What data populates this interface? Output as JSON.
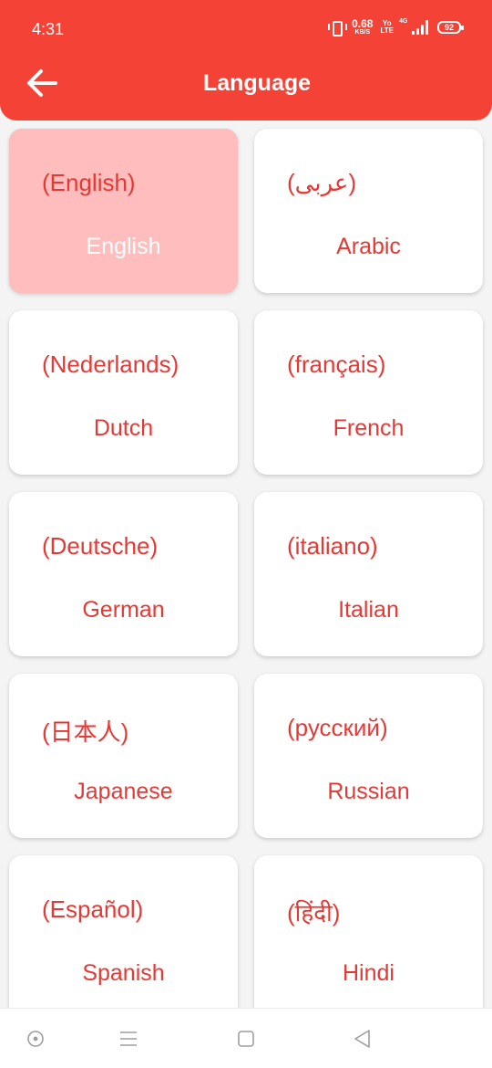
{
  "status_bar": {
    "time": "4:31",
    "speed_value": "0.68",
    "speed_unit": "KB/S",
    "volte_top": "Yo",
    "volte_bottom": "LTE",
    "network": "4G",
    "battery": "92"
  },
  "header": {
    "title": "Language",
    "back_icon": "arrow-left-icon"
  },
  "languages": [
    {
      "native": "(English)",
      "english": "English",
      "selected": true
    },
    {
      "native": "(عربى)",
      "english": "Arabic",
      "selected": false
    },
    {
      "native": "(Nederlands)",
      "english": "Dutch",
      "selected": false
    },
    {
      "native": "(français)",
      "english": "French",
      "selected": false
    },
    {
      "native": "(Deutsche)",
      "english": "German",
      "selected": false
    },
    {
      "native": "(italiano)",
      "english": "Italian",
      "selected": false
    },
    {
      "native": "(日本人)",
      "english": "Japanese",
      "selected": false
    },
    {
      "native": "(русский)",
      "english": "Russian",
      "selected": false
    },
    {
      "native": "(Español)",
      "english": "Spanish",
      "selected": false
    },
    {
      "native": "(हिंदी)",
      "english": "Hindi",
      "selected": false
    }
  ],
  "nav_bar": {
    "icons": [
      "assistant-circle-icon",
      "menu-icon",
      "home-square-icon",
      "back-triangle-icon"
    ]
  },
  "colors": {
    "accent": "#f44336",
    "text_red": "#e53935",
    "selected_bg": "#ffbdbd"
  }
}
